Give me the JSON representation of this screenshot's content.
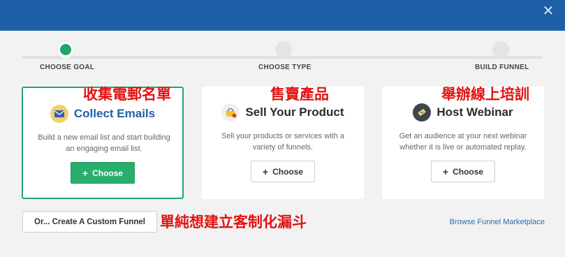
{
  "header": {
    "close_icon": "close-icon"
  },
  "steps": [
    {
      "label": "CHOOSE GOAL",
      "active": true
    },
    {
      "label": "CHOOSE TYPE",
      "active": false
    },
    {
      "label": "BUILD FUNNEL",
      "active": false
    }
  ],
  "annotations": {
    "collect": "收集電郵名單",
    "sell": "售賣產品",
    "webinar": "舉辦線上培訓",
    "custom": "單純想建立客制化漏斗"
  },
  "cards": [
    {
      "title": "Collect Emails",
      "desc": "Build a new email list and start building an engaging email list.",
      "button": "Choose",
      "icon": "envelope-icon"
    },
    {
      "title": "Sell Your Product",
      "desc": "Sell your products or services with a variety of funnels.",
      "button": "Choose",
      "icon": "shopping-basket-icon"
    },
    {
      "title": "Host Webinar",
      "desc": "Get an audience at your next webinar whether it is live or automated replay.",
      "button": "Choose",
      "icon": "ticket-icon"
    }
  ],
  "footer": {
    "custom_button": "Or... Create A Custom Funnel",
    "browse_link": "Browse Funnel Marketplace"
  },
  "colors": {
    "header": "#1f5fa8",
    "accent_green": "#27ae6c",
    "annotation_red": "#e31313",
    "link_blue": "#2a6db0"
  }
}
